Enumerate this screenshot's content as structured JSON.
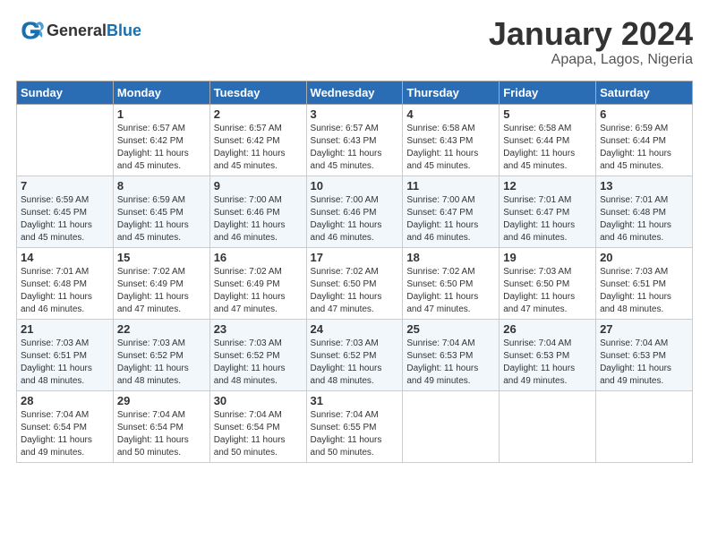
{
  "header": {
    "logo_general": "General",
    "logo_blue": "Blue",
    "month_title": "January 2024",
    "location": "Apapa, Lagos, Nigeria"
  },
  "days_of_week": [
    "Sunday",
    "Monday",
    "Tuesday",
    "Wednesday",
    "Thursday",
    "Friday",
    "Saturday"
  ],
  "weeks": [
    [
      {
        "day": "",
        "info": ""
      },
      {
        "day": "1",
        "info": "Sunrise: 6:57 AM\nSunset: 6:42 PM\nDaylight: 11 hours\nand 45 minutes."
      },
      {
        "day": "2",
        "info": "Sunrise: 6:57 AM\nSunset: 6:42 PM\nDaylight: 11 hours\nand 45 minutes."
      },
      {
        "day": "3",
        "info": "Sunrise: 6:57 AM\nSunset: 6:43 PM\nDaylight: 11 hours\nand 45 minutes."
      },
      {
        "day": "4",
        "info": "Sunrise: 6:58 AM\nSunset: 6:43 PM\nDaylight: 11 hours\nand 45 minutes."
      },
      {
        "day": "5",
        "info": "Sunrise: 6:58 AM\nSunset: 6:44 PM\nDaylight: 11 hours\nand 45 minutes."
      },
      {
        "day": "6",
        "info": "Sunrise: 6:59 AM\nSunset: 6:44 PM\nDaylight: 11 hours\nand 45 minutes."
      }
    ],
    [
      {
        "day": "7",
        "info": "Sunrise: 6:59 AM\nSunset: 6:45 PM\nDaylight: 11 hours\nand 45 minutes."
      },
      {
        "day": "8",
        "info": "Sunrise: 6:59 AM\nSunset: 6:45 PM\nDaylight: 11 hours\nand 45 minutes."
      },
      {
        "day": "9",
        "info": "Sunrise: 7:00 AM\nSunset: 6:46 PM\nDaylight: 11 hours\nand 46 minutes."
      },
      {
        "day": "10",
        "info": "Sunrise: 7:00 AM\nSunset: 6:46 PM\nDaylight: 11 hours\nand 46 minutes."
      },
      {
        "day": "11",
        "info": "Sunrise: 7:00 AM\nSunset: 6:47 PM\nDaylight: 11 hours\nand 46 minutes."
      },
      {
        "day": "12",
        "info": "Sunrise: 7:01 AM\nSunset: 6:47 PM\nDaylight: 11 hours\nand 46 minutes."
      },
      {
        "day": "13",
        "info": "Sunrise: 7:01 AM\nSunset: 6:48 PM\nDaylight: 11 hours\nand 46 minutes."
      }
    ],
    [
      {
        "day": "14",
        "info": "Sunrise: 7:01 AM\nSunset: 6:48 PM\nDaylight: 11 hours\nand 46 minutes."
      },
      {
        "day": "15",
        "info": "Sunrise: 7:02 AM\nSunset: 6:49 PM\nDaylight: 11 hours\nand 47 minutes."
      },
      {
        "day": "16",
        "info": "Sunrise: 7:02 AM\nSunset: 6:49 PM\nDaylight: 11 hours\nand 47 minutes."
      },
      {
        "day": "17",
        "info": "Sunrise: 7:02 AM\nSunset: 6:50 PM\nDaylight: 11 hours\nand 47 minutes."
      },
      {
        "day": "18",
        "info": "Sunrise: 7:02 AM\nSunset: 6:50 PM\nDaylight: 11 hours\nand 47 minutes."
      },
      {
        "day": "19",
        "info": "Sunrise: 7:03 AM\nSunset: 6:50 PM\nDaylight: 11 hours\nand 47 minutes."
      },
      {
        "day": "20",
        "info": "Sunrise: 7:03 AM\nSunset: 6:51 PM\nDaylight: 11 hours\nand 48 minutes."
      }
    ],
    [
      {
        "day": "21",
        "info": "Sunrise: 7:03 AM\nSunset: 6:51 PM\nDaylight: 11 hours\nand 48 minutes."
      },
      {
        "day": "22",
        "info": "Sunrise: 7:03 AM\nSunset: 6:52 PM\nDaylight: 11 hours\nand 48 minutes."
      },
      {
        "day": "23",
        "info": "Sunrise: 7:03 AM\nSunset: 6:52 PM\nDaylight: 11 hours\nand 48 minutes."
      },
      {
        "day": "24",
        "info": "Sunrise: 7:03 AM\nSunset: 6:52 PM\nDaylight: 11 hours\nand 48 minutes."
      },
      {
        "day": "25",
        "info": "Sunrise: 7:04 AM\nSunset: 6:53 PM\nDaylight: 11 hours\nand 49 minutes."
      },
      {
        "day": "26",
        "info": "Sunrise: 7:04 AM\nSunset: 6:53 PM\nDaylight: 11 hours\nand 49 minutes."
      },
      {
        "day": "27",
        "info": "Sunrise: 7:04 AM\nSunset: 6:53 PM\nDaylight: 11 hours\nand 49 minutes."
      }
    ],
    [
      {
        "day": "28",
        "info": "Sunrise: 7:04 AM\nSunset: 6:54 PM\nDaylight: 11 hours\nand 49 minutes."
      },
      {
        "day": "29",
        "info": "Sunrise: 7:04 AM\nSunset: 6:54 PM\nDaylight: 11 hours\nand 50 minutes."
      },
      {
        "day": "30",
        "info": "Sunrise: 7:04 AM\nSunset: 6:54 PM\nDaylight: 11 hours\nand 50 minutes."
      },
      {
        "day": "31",
        "info": "Sunrise: 7:04 AM\nSunset: 6:55 PM\nDaylight: 11 hours\nand 50 minutes."
      },
      {
        "day": "",
        "info": ""
      },
      {
        "day": "",
        "info": ""
      },
      {
        "day": "",
        "info": ""
      }
    ]
  ]
}
